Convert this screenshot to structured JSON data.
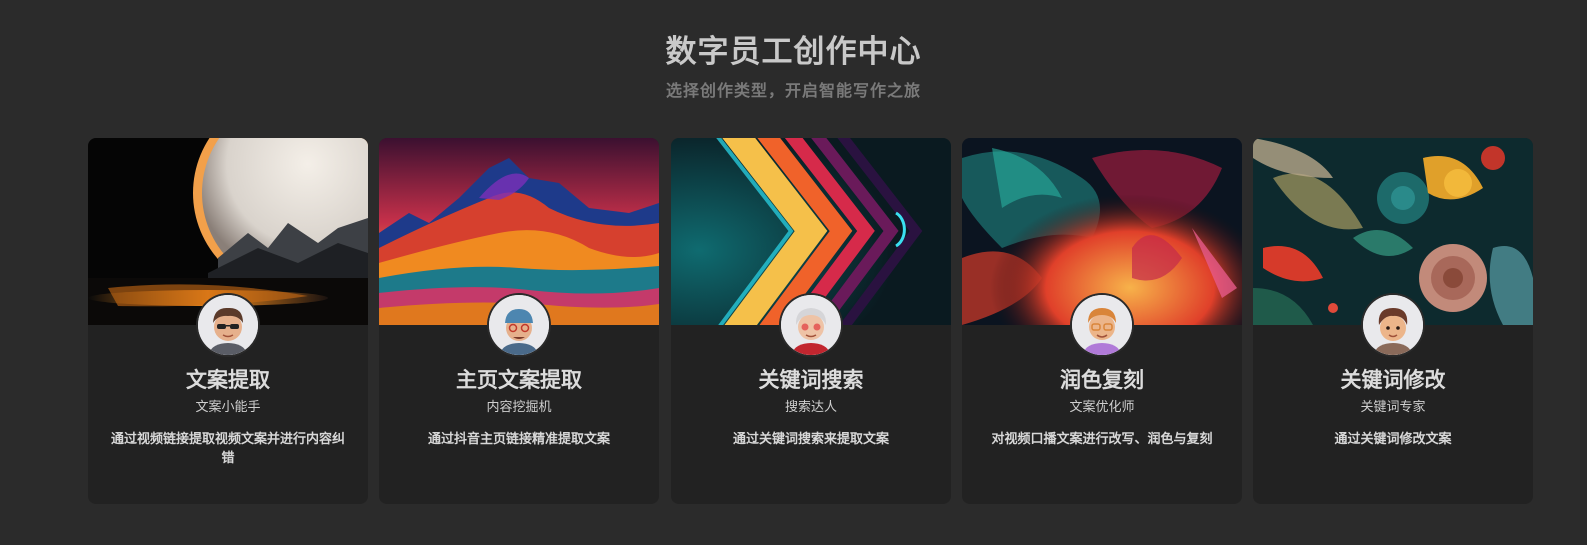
{
  "header": {
    "title": "数字员工创作中心",
    "subtitle": "选择创作类型，开启智能写作之旅"
  },
  "cards": [
    {
      "title": "文案提取",
      "role": "文案小能手",
      "description": "通过视频链接提取视频文案并进行内容纠错",
      "image": "eclipse-landscape",
      "avatar": "avatar-sunglasses-icon"
    },
    {
      "title": "主页文案提取",
      "role": "内容挖掘机",
      "description": "通过抖音主页链接精准提取文案",
      "image": "rainbow-mountains",
      "avatar": "avatar-cap-icon"
    },
    {
      "title": "关键词搜索",
      "role": "搜索达人",
      "description": "通过关键词搜索来提取文案",
      "image": "neon-chevrons",
      "avatar": "avatar-grandma-icon"
    },
    {
      "title": "润色复刻",
      "role": "文案优化师",
      "description": "对视频口播文案进行改写、润色与复刻",
      "image": "abstract-smoke",
      "avatar": "avatar-glasses-icon"
    },
    {
      "title": "关键词修改",
      "role": "关键词专家",
      "description": "通过关键词修改文案",
      "image": "tropical-flowers",
      "avatar": "avatar-boy-icon"
    }
  ]
}
